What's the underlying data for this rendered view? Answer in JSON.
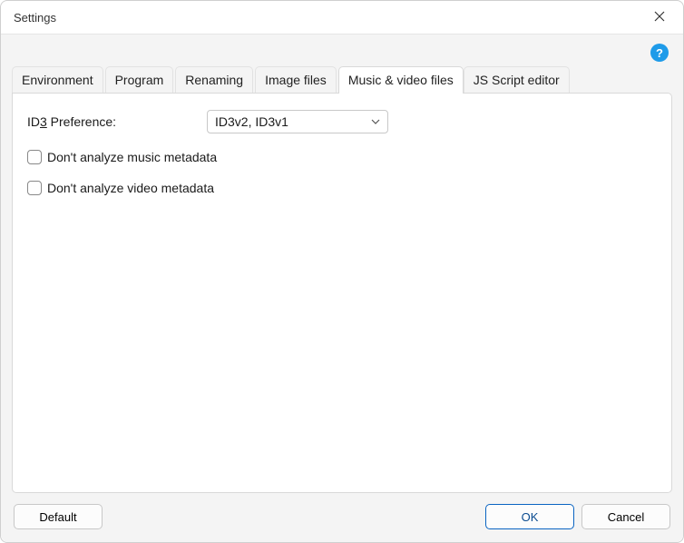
{
  "window": {
    "title": "Settings"
  },
  "help": {
    "glyph": "?"
  },
  "tabs": [
    {
      "label": "Environment",
      "active": false
    },
    {
      "label": "Program",
      "active": false
    },
    {
      "label": "Renaming",
      "active": false
    },
    {
      "label": "Image files",
      "active": false
    },
    {
      "label": "Music & video files",
      "active": true
    },
    {
      "label": "JS Script editor",
      "active": false
    }
  ],
  "id3": {
    "label_pre": "ID",
    "label_u": "3",
    "label_post": " Preference:",
    "selected": "ID3v2, ID3v1"
  },
  "checks": {
    "no_music": {
      "label": "Don't analyze music metadata",
      "checked": false
    },
    "no_video": {
      "label": "Don't analyze video metadata",
      "checked": false
    }
  },
  "footer": {
    "default_label": "Default",
    "ok_label": "OK",
    "cancel_label": "Cancel"
  }
}
